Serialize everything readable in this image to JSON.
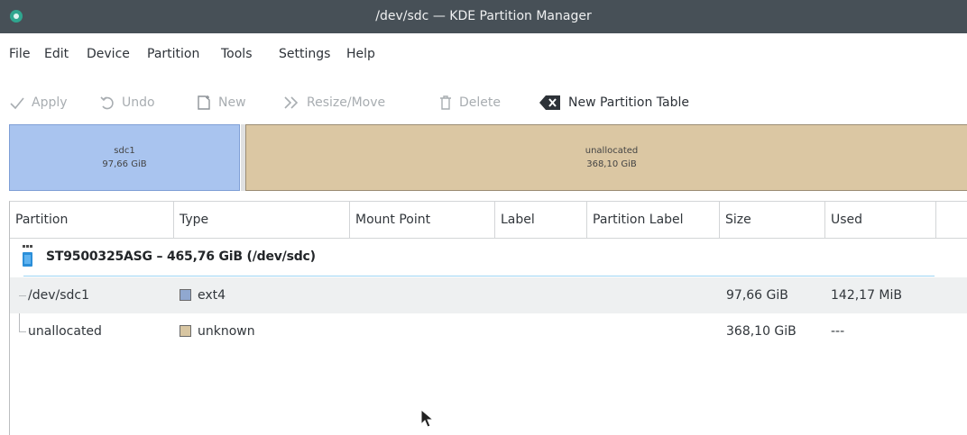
{
  "window": {
    "title": "/dev/sdc — KDE Partition Manager"
  },
  "menu": [
    "File",
    "Edit",
    "Device",
    "Partition",
    "Tools",
    "Settings",
    "Help"
  ],
  "toolbar": {
    "apply": "Apply",
    "undo": "Undo",
    "new": "New",
    "resize_move": "Resize/Move",
    "delete": "Delete",
    "new_partition_table": "New Partition Table"
  },
  "partition_bar": {
    "used": {
      "name": "sdc1",
      "size": "97,66 GiB"
    },
    "free": {
      "name": "unallocated",
      "size": "368,10 GiB"
    }
  },
  "table": {
    "columns": [
      "Partition",
      "Type",
      "Mount Point",
      "Label",
      "Partition Label",
      "Size",
      "Used"
    ],
    "device": "ST9500325ASG – 465,76 GiB (/dev/sdc)",
    "rows": [
      {
        "partition": "/dev/sdc1",
        "type": "ext4",
        "type_color": "#90a8d0",
        "size": "97,66 GiB",
        "used": "142,17 MiB"
      },
      {
        "partition": "unallocated",
        "type": "unknown",
        "type_color": "#d8c6a2",
        "size": "368,10 GiB",
        "used": "---"
      }
    ]
  },
  "colors": {
    "titlebar": "#475057",
    "used_partition": "#a9c4ef",
    "unallocated": "#dbc7a3",
    "selection": "#3daee9"
  }
}
